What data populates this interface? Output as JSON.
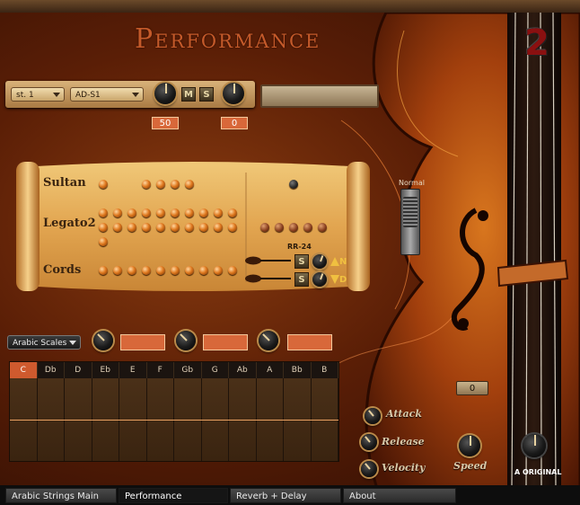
{
  "header": {
    "title": "Performance",
    "logo_text": "2"
  },
  "controls": {
    "preset_select": "st. 1",
    "articulation_select": "AD-S1",
    "mute_label": "M",
    "solo_label": "S",
    "knob1_value": "50",
    "knob2_value": "0"
  },
  "articulations": {
    "rows": [
      {
        "label": "Sultan"
      },
      {
        "label": "Legato2"
      },
      {
        "label": "Cords"
      }
    ],
    "rr_label": "RR-24",
    "rr_s_label": "S",
    "up_label": "N",
    "down_label": "D"
  },
  "mode": {
    "label": "Normal"
  },
  "scales": {
    "select": "Arabic Scales",
    "notes": [
      "C",
      "Db",
      "D",
      "Eb",
      "E",
      "F",
      "Gb",
      "G",
      "Ab",
      "A",
      "Bb",
      "B"
    ],
    "selected_note": "C"
  },
  "envelope": {
    "attack_label": "Attack",
    "release_label": "Release",
    "velocity_label": "Velocity",
    "speed_label": "Speed",
    "speed_value": "0",
    "original_label": "A ORIGINAL"
  },
  "tabs": [
    {
      "label": "Arabic Strings Main"
    },
    {
      "label": "Performance"
    },
    {
      "label": "Reverb + Delay"
    },
    {
      "label": "About"
    }
  ],
  "colors": {
    "accent": "#d8683a",
    "title": "#c45a2a",
    "background": "#5a1e06"
  }
}
